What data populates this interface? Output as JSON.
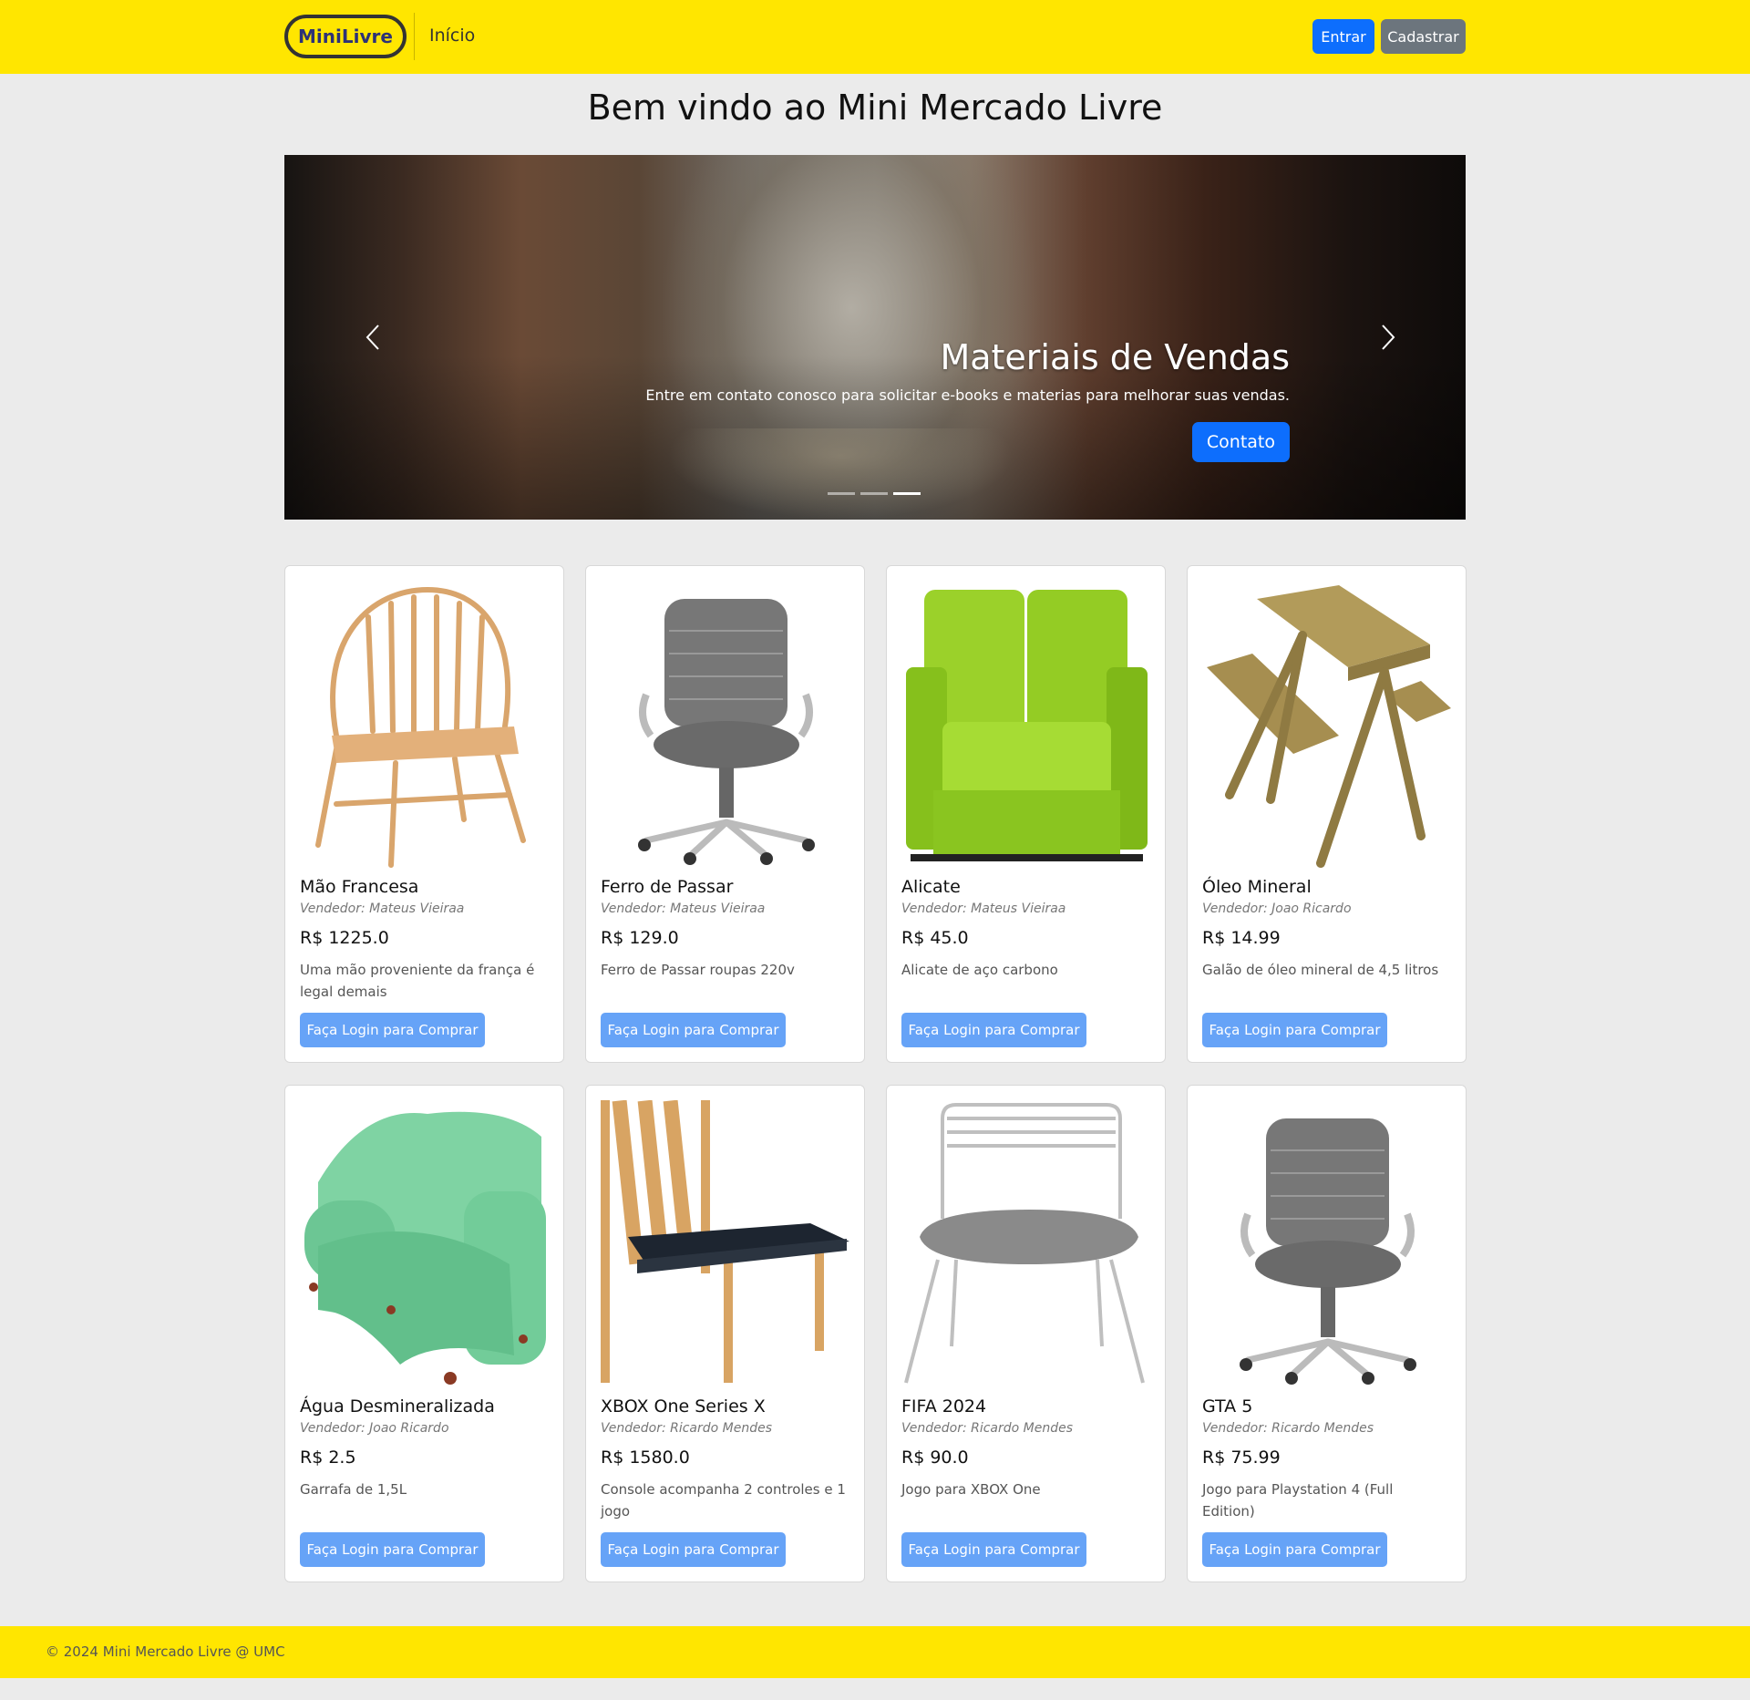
{
  "nav": {
    "brand": "MiniLivre",
    "home_link": "Início",
    "login_label": "Entrar",
    "signup_label": "Cadastrar"
  },
  "page": {
    "title": "Bem vindo ao Mini Mercado Livre"
  },
  "carousel": {
    "caption_title": "Materiais de Vendas",
    "caption_text": "Entre em contato conosco para solicitar e-books e materias para melhorar suas vendas.",
    "button_label": "Contato",
    "slide_count": 3,
    "active_slide": 3
  },
  "products": [
    {
      "name": "Mão Francesa",
      "seller": "Vendedor: Mateus Vieiraa",
      "price": "R$ 1225.0",
      "description": "Uma mão proveniente da frança é legal demais",
      "button": "Faça Login para Comprar",
      "image": "wooden-windsor-chair"
    },
    {
      "name": "Ferro de Passar",
      "seller": "Vendedor: Mateus Vieiraa",
      "price": "R$ 129.0",
      "description": "Ferro de Passar roupas 220v",
      "button": "Faça Login para Comprar",
      "image": "grey-office-chair"
    },
    {
      "name": "Alicate",
      "seller": "Vendedor: Mateus Vieiraa",
      "price": "R$ 45.0",
      "description": "Alicate de aço carbono",
      "button": "Faça Login para Comprar",
      "image": "lime-green-loveseat"
    },
    {
      "name": "Óleo Mineral",
      "seller": "Vendedor: Joao Ricardo",
      "price": "R$ 14.99",
      "description": "Galão de óleo mineral de 4,5 litros",
      "button": "Faça Login para Comprar",
      "image": "wooden-picnic-table"
    },
    {
      "name": "Água Desmineralizada",
      "seller": "Vendedor: Joao Ricardo",
      "price": "R$ 2.5",
      "description": "Garrafa de 1,5L",
      "button": "Faça Login para Comprar",
      "image": "mint-tufted-sofa"
    },
    {
      "name": "XBOX One Series X",
      "seller": "Vendedor: Ricardo Mendes",
      "price": "R$ 1580.0",
      "description": "Console acompanha 2 controles e 1 jogo",
      "button": "Faça Login para Comprar",
      "image": "wooden-dining-chair"
    },
    {
      "name": "FIFA 2024",
      "seller": "Vendedor: Ricardo Mendes",
      "price": "R$ 90.0",
      "description": "Jogo para XBOX One",
      "button": "Faça Login para Comprar",
      "image": "metal-wire-chair"
    },
    {
      "name": "GTA 5",
      "seller": "Vendedor: Ricardo Mendes",
      "price": "R$ 75.99",
      "description": "Jogo para Playstation 4 (Full Edition)",
      "button": "Faça Login para Comprar",
      "image": "grey-office-chair"
    }
  ],
  "footer": {
    "text": "© 2024 Mini Mercado Livre @ UMC"
  },
  "colors": {
    "brand_yellow": "#ffe600",
    "primary_blue": "#0d6efd",
    "secondary_grey": "#6c757d",
    "card_button_blue": "#66a3f7",
    "page_background": "#ebebeb"
  }
}
